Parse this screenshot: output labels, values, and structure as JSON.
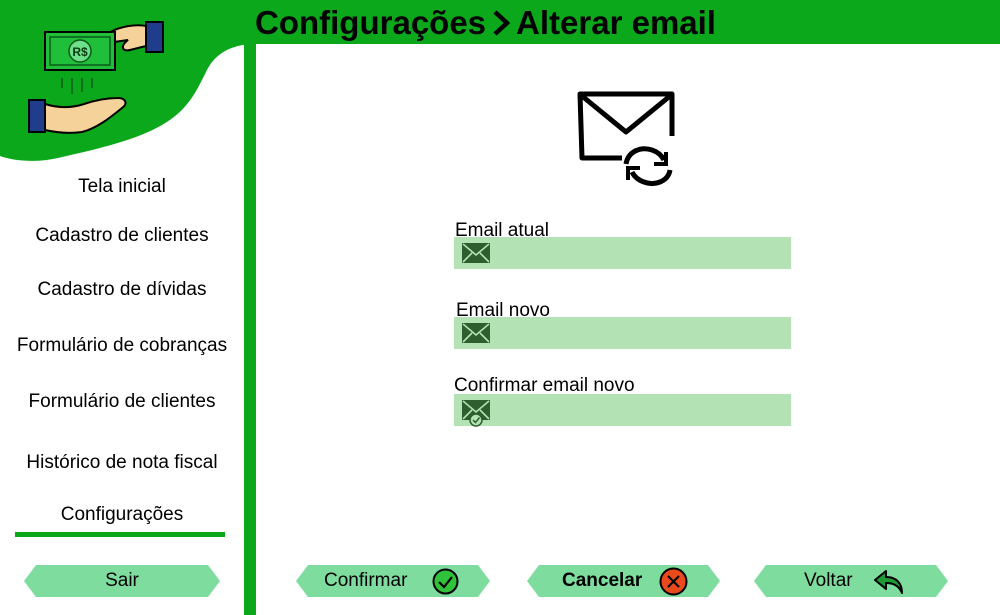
{
  "header": {
    "section": "Configurações",
    "separator_icon": "chevron-right-icon",
    "subsection": "Alterar email"
  },
  "logo": {
    "icon": "money-hand-logo",
    "bill_text": "R$"
  },
  "sidebar": {
    "items": [
      {
        "label": "Tela inicial"
      },
      {
        "label": "Cadastro de clientes"
      },
      {
        "label": "Cadastro de dívidas"
      },
      {
        "label": "Formulário de cobranças"
      },
      {
        "label": "Formulário de clientes"
      },
      {
        "label": "Histórico de nota fiscal"
      },
      {
        "label": "Configurações",
        "active": true
      }
    ],
    "logout_label": "Sair"
  },
  "main": {
    "hero_icon": "email-refresh-icon",
    "fields": [
      {
        "label": "Email atual",
        "value": "",
        "icon": "envelope-icon"
      },
      {
        "label": "Email novo",
        "value": "",
        "icon": "envelope-icon"
      },
      {
        "label": "Confirmar email novo",
        "value": "",
        "icon": "envelope-check-icon"
      }
    ]
  },
  "actions": {
    "confirm": {
      "label": "Confirmar",
      "icon": "check-circle-icon"
    },
    "cancel": {
      "label": "Cancelar",
      "icon": "cancel-circle-icon"
    },
    "back": {
      "label": "Voltar",
      "icon": "return-arrow-icon"
    }
  },
  "colors": {
    "brand_green": "#0aa81a",
    "pill_green": "#7fdc9f",
    "field_green": "#b3e2b4",
    "icon_green": "#2e5e2e",
    "cancel_red": "#e84a1c"
  }
}
